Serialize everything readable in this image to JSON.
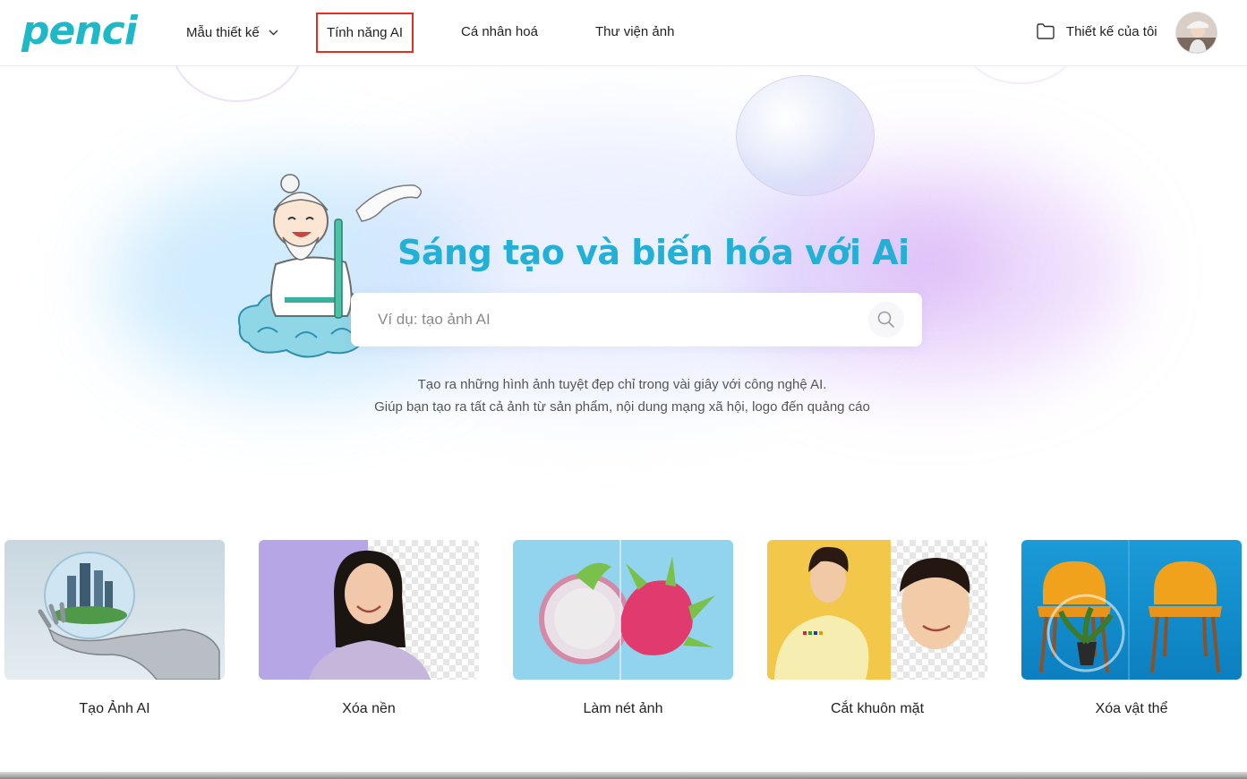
{
  "header": {
    "logo": "penci",
    "nav": {
      "templates": "Mẫu thiết kế",
      "ai_features": "Tính năng AI",
      "personalize": "Cá nhân hoá",
      "gallery": "Thư viện ảnh"
    },
    "my_designs": "Thiết kế của tôi"
  },
  "hero": {
    "title": "Sáng tạo và biến hóa với Ai",
    "search_placeholder": "Ví dụ: tạo ảnh AI",
    "desc_line1": "Tạo ra những hình ảnh tuyệt đẹp chỉ trong vài giây với công nghệ AI.",
    "desc_line2": "Giúp bạn tạo ra tất cả ảnh từ sản phẩm, nội dung mạng xã hội, logo đến quảng cáo"
  },
  "features": [
    {
      "label": "Tạo Ảnh AI",
      "icon": "ai-image"
    },
    {
      "label": "Xóa nền",
      "icon": "remove-background"
    },
    {
      "label": "Làm nét ảnh",
      "icon": "sharpen-image"
    },
    {
      "label": "Cắt khuôn mặt",
      "icon": "face-cutout"
    },
    {
      "label": "Xóa vật thể",
      "icon": "remove-object"
    }
  ],
  "colors": {
    "brand": "#1fb8c9",
    "title": "#22b0d6",
    "highlight_border": "#e0311e"
  }
}
